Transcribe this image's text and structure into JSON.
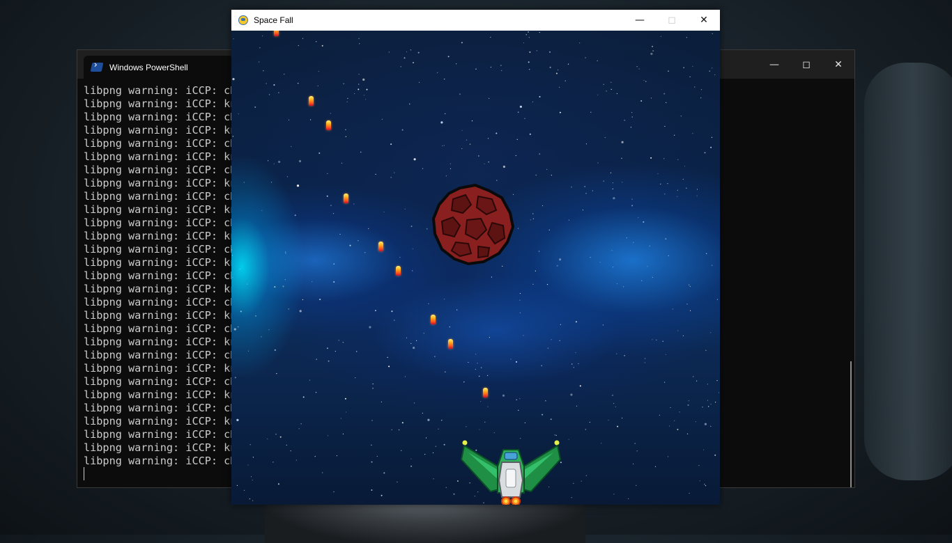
{
  "desktop": {
    "powershell": {
      "tab_title": "Windows PowerShell",
      "lines": [
        "libpng warning: iCCP: cH",
        "libpng warning: iCCP: kn",
        "libpng warning: iCCP: cH",
        "libpng warning: iCCP: kn",
        "libpng warning: iCCP: cH",
        "libpng warning: iCCP: kn",
        "libpng warning: iCCP: cH",
        "libpng warning: iCCP: kn",
        "libpng warning: iCCP: cH",
        "libpng warning: iCCP: kn",
        "libpng warning: iCCP: cH",
        "libpng warning: iCCP: kn",
        "libpng warning: iCCP: cH",
        "libpng warning: iCCP: kn",
        "libpng warning: iCCP: cH",
        "libpng warning: iCCP: kn",
        "libpng warning: iCCP: cH",
        "libpng warning: iCCP: kn",
        "libpng warning: iCCP: cH",
        "libpng warning: iCCP: kn",
        "libpng warning: iCCP: cH",
        "libpng warning: iCCP: kn",
        "libpng warning: iCCP: cH",
        "libpng warning: iCCP: kn",
        "libpng warning: iCCP: cH",
        "libpng warning: iCCP: kn",
        "libpng warning: iCCP: cH",
        "libpng warning: iCCP: kn",
        "libpng warning: iCCP: cH"
      ],
      "controls": {
        "minimize_icon": "minimize-icon",
        "maximize_icon": "maximize-icon",
        "close_icon": "close-icon"
      }
    },
    "game": {
      "title": "Space Fall",
      "app_icon": "pygame-icon",
      "controls": {
        "minimize_icon": "minimize-icon",
        "maximize_icon": "maximize-icon-disabled",
        "close_icon": "close-icon"
      },
      "sprites": {
        "asteroid": "red-asteroid",
        "ship": "green-player-spaceship",
        "bullet_count": 10
      }
    }
  }
}
